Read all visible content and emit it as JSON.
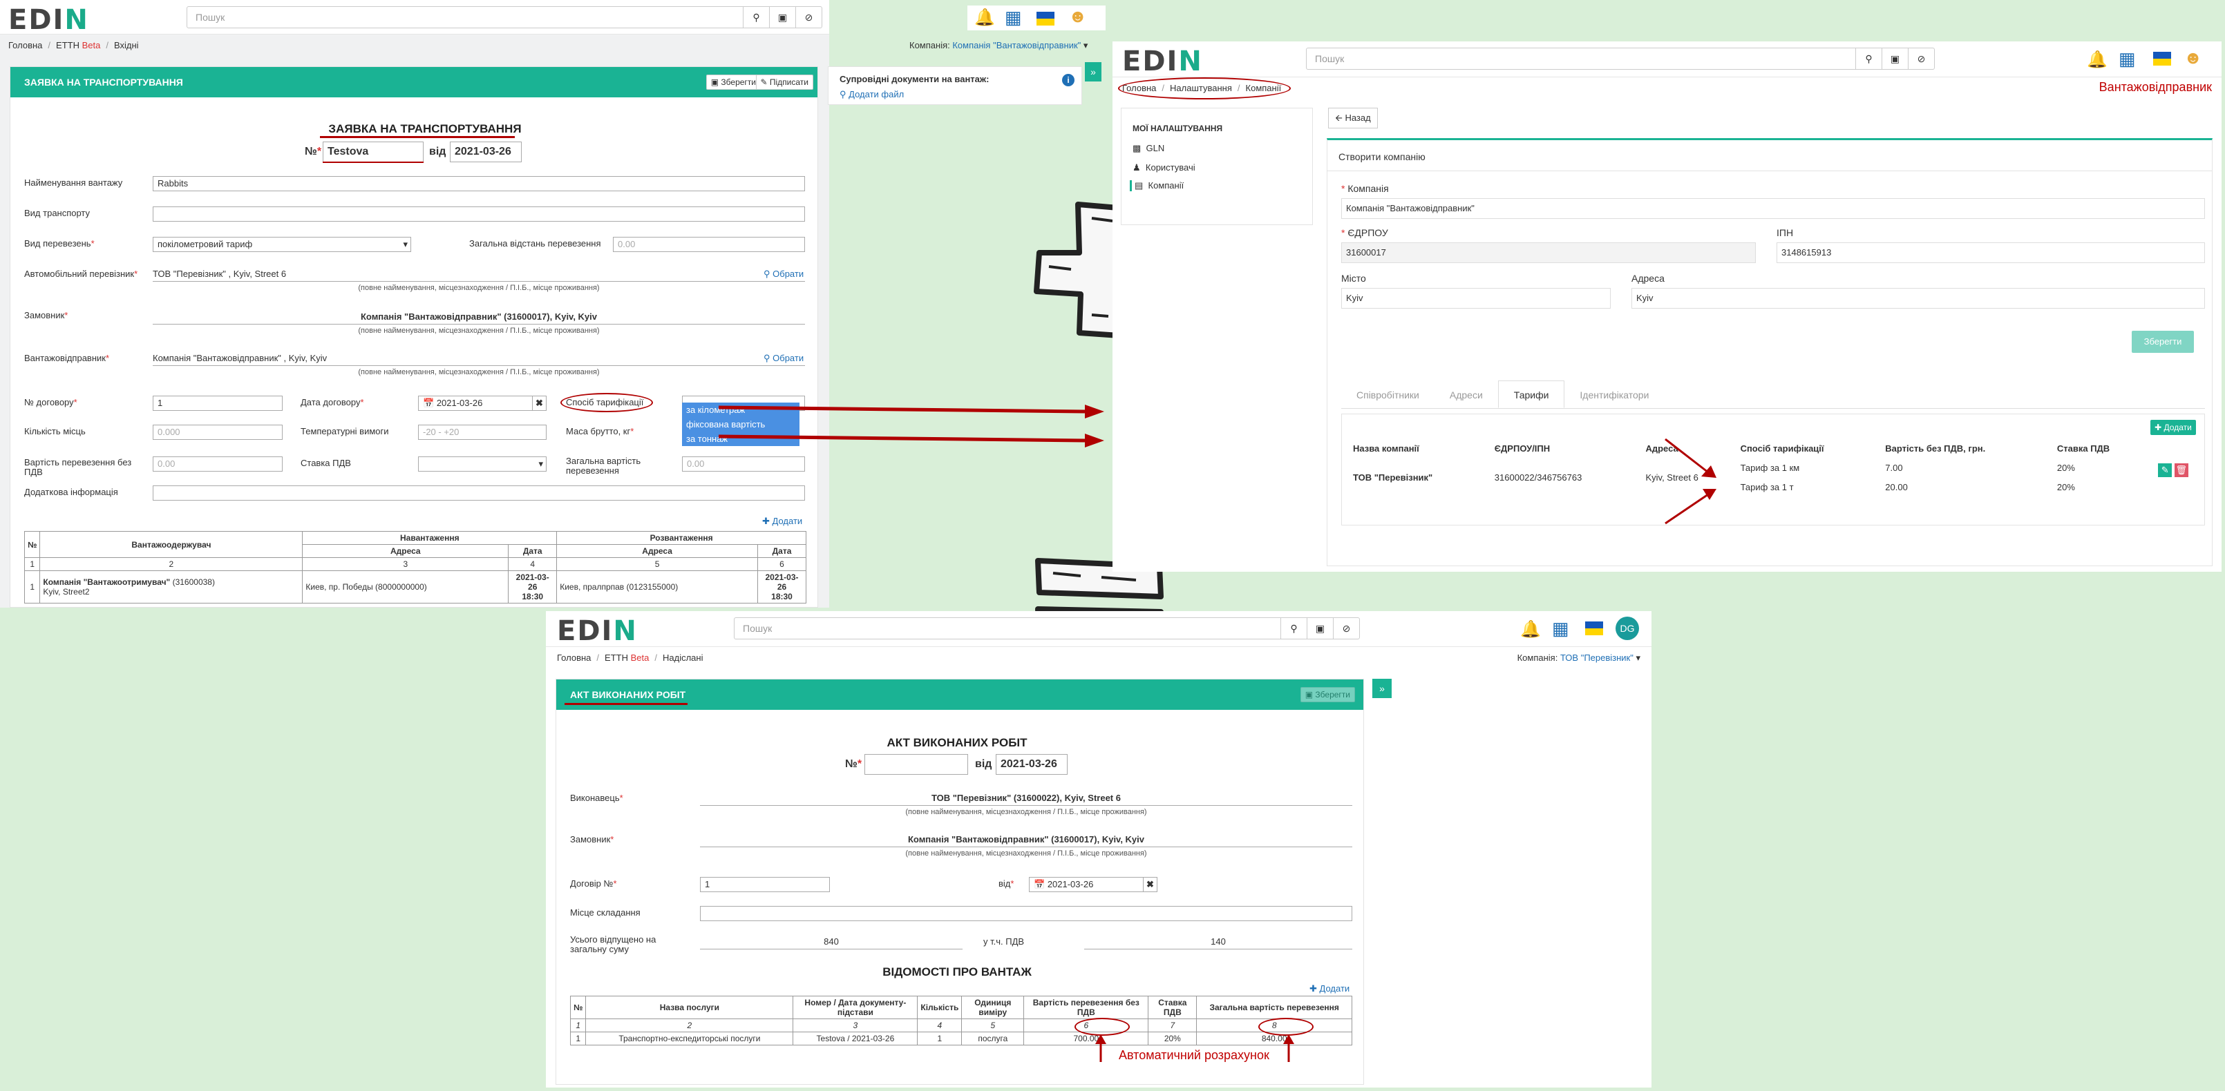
{
  "shot1": {
    "logo": "EDIN",
    "search_placeholder": "Пошук",
    "breadcrumb": [
      "Головна",
      "ЕТТН",
      "Beta",
      "Вхідні"
    ],
    "company_label": "Компанія:",
    "company_value": "Компанія \"Вантажовідправник\"",
    "panel_title": "ЗАЯВКА НА ТРАНСПОРТУВАННЯ",
    "save": "Зберегти",
    "sign": "Підписати",
    "side_title": "Супровідні документи на вантаж:",
    "add_file": "Додати файл",
    "doc_title": "ЗАЯВКА НА ТРАНСПОРТУВАННЯ",
    "number_label": "№",
    "number_value": "Testova",
    "from_label": "від",
    "date_value": "2021-03-26",
    "cargo_name_label": "Найменування вантажу",
    "cargo_name_value": "Rabbits",
    "transport_kind_label": "Вид транспорту",
    "carriage_kind_label": "Вид перевезень",
    "carriage_kind_value": "покілометровий тариф",
    "total_distance_label": "Загальна відстань перевезення",
    "total_distance_placeholder": "0.00",
    "carrier_label": "Автомобільний перевізник",
    "carrier_value": "ТОВ \"Перевізник\" , Kyiv, Street 6",
    "choose": "Обрати",
    "hint_full": "(повне найменування, місцезнаходження / П.І.Б., місце проживання)",
    "customer_label": "Замовник",
    "customer_value": "Компанія \"Вантажовідправник\" (31600017), Kyiv, Kyiv",
    "shipper_label": "Вантажовідправник",
    "shipper_value": "Компанія \"Вантажовідправник\" , Kyiv, Kyiv",
    "contract_no_label": "№ договору",
    "contract_no_value": "1",
    "contract_date_label": "Дата договору",
    "contract_date_value": "2021-03-26",
    "tariff_method_label": "Спосіб тарифікації",
    "tariff_options": [
      "за кілометраж",
      "фіксована вартість",
      "за тоннаж"
    ],
    "places_label": "Кількість місць",
    "places_placeholder": "0.000",
    "temp_label": "Температурні вимоги",
    "temp_placeholder": "-20 - +20",
    "mass_label": "Маса брутто, кг",
    "cost_label": "Вартість перевезення без ПДВ",
    "cost_placeholder": "0.00",
    "vat_rate_label": "Ставка ПДВ",
    "total_cost_label": "Загальна вартість перевезення",
    "total_cost_placeholder": "0.00",
    "extra_label": "Додаткова інформація",
    "add": "Додати",
    "table": {
      "h_no": "№",
      "h_consignee": "Вантажоодержувач",
      "h_loading": "Навантаження",
      "h_unloading": "Розвантаження",
      "h_address": "Адреса",
      "h_date": "Дата",
      "nums": [
        "1",
        "2",
        "3",
        "4",
        "5",
        "6"
      ],
      "row_no": "1",
      "row_consignee": "Компанія \"Вантажоотримувач\"",
      "row_consignee_code": "(31600038)",
      "row_consignee_addr": "Kyiv, Street2",
      "row_load_addr": "Киев, пр. Победы (8000000000)",
      "row_load_date": "2021-03-26",
      "row_load_time": "18:30",
      "row_unload_addr": "Киев, пралпрпав (0123155000)",
      "row_unload_date": "2021-03-26",
      "row_unload_time": "18:30"
    }
  },
  "shot2": {
    "logo": "EDIN",
    "search_placeholder": "Пошук",
    "breadcrumb": [
      "Головна",
      "Налаштування",
      "Компанії"
    ],
    "role_note": "Вантажовідправник",
    "back": "Назад",
    "side_title": "МОЇ НАЛАШТУВАННЯ",
    "side_items": [
      "GLN",
      "Користувачі",
      "Компанії"
    ],
    "create_title": "Створити компанію",
    "company_label": "Компанія",
    "company_value": "Компанія \"Вантажовідправник\"",
    "edrpou_label": "ЄДРПОУ",
    "edrpou_value": "31600017",
    "ipn_label": "ІПН",
    "ipn_value": "3148615913",
    "city_label": "Місто",
    "city_value": "Kyiv",
    "address_label": "Адреса",
    "address_value": "Kyiv",
    "save": "Зберегти",
    "tabs": [
      "Співробітники",
      "Адреси",
      "Тарифи",
      "Ідентифікатори"
    ],
    "add": "Додати",
    "table": {
      "headers": [
        "Назва компанії",
        "ЄДРПОУ/ІПН",
        "Адреса",
        "Спосіб тарифікації",
        "Вартість без ПДВ, грн.",
        "Ставка ПДВ"
      ],
      "company": "ТОВ \"Перевізник\"",
      "code": "31600022/346756763",
      "address": "Kyiv, Street 6",
      "rows": [
        {
          "method": "Тариф за 1 км",
          "price": "7.00",
          "vat": "20%"
        },
        {
          "method": "Тариф за 1 т",
          "price": "20.00",
          "vat": "20%"
        }
      ]
    }
  },
  "shot3": {
    "logo": "EDIN",
    "search_placeholder": "Пошук",
    "avatar": "DG",
    "breadcrumb": [
      "Головна",
      "ЕТТН",
      "Beta",
      "Надіслані"
    ],
    "company_label": "Компанія:",
    "company_value": "ТОВ \"Перевізник\"",
    "panel_title": "АКТ ВИКОНАНИХ РОБІТ",
    "save": "Зберегти",
    "doc_title": "АКТ ВИКОНАНИХ РОБІТ",
    "number_label": "№",
    "from_label": "від",
    "date_value": "2021-03-26",
    "executor_label": "Виконавець",
    "executor_value": "ТОВ \"Перевізник\" (31600022), Kyiv, Street 6",
    "hint_full": "(повне найменування, місцезнаходження / П.І.Б., місце проживання)",
    "customer_label": "Замовник",
    "customer_value": "Компанія \"Вантажовідправник\" (31600017), Kyiv, Kyiv",
    "contract_label": "Договір №",
    "contract_value": "1",
    "contract_from": "від",
    "contract_date": "2021-03-26",
    "place_label": "Місце складання",
    "total_label": "Усього відпущено на загальну суму",
    "total_value": "840",
    "vat_label": "у т.ч. ПДВ",
    "vat_value": "140",
    "cargo_title": "ВІДОМОСТІ ПРО ВАНТАЖ",
    "add": "Додати",
    "table": {
      "headers": [
        "№",
        "Назва послуги",
        "Номер / Дата документу-підстави",
        "Кількість",
        "Одиниця виміру",
        "Вартість перевезення без ПДВ",
        "Ставка ПДВ",
        "Загальна вартість перевезення"
      ],
      "nums": [
        "1",
        "2",
        "3",
        "4",
        "5",
        "6",
        "7",
        "8"
      ],
      "row": [
        "1",
        "Транспортно-експедиторські послуги",
        "Testova / 2021-03-26",
        "1",
        "послуга",
        "700.00",
        "20%",
        "840.00"
      ]
    },
    "auto_note": "Автоматичний розрахунок"
  },
  "colors": {
    "accent": "#1ab394",
    "annotation_red": "#b00000",
    "link": "#1f6fb5"
  }
}
